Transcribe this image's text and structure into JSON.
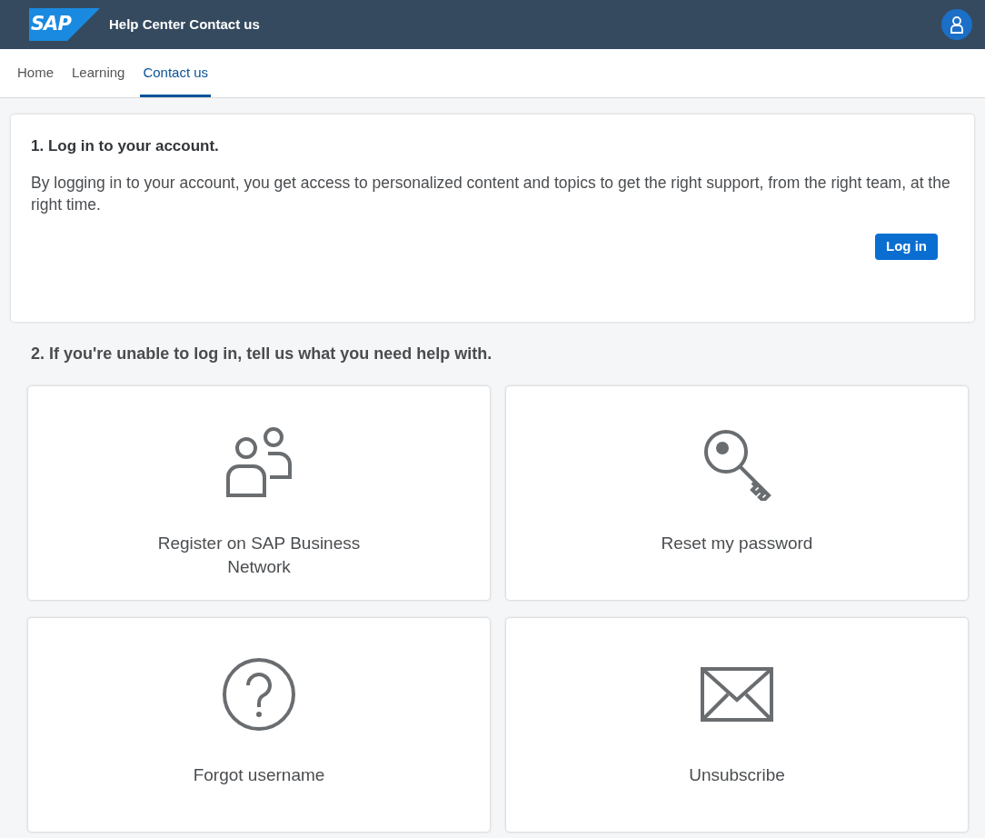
{
  "header": {
    "logo": "SAP",
    "title": "Help Center Contact us"
  },
  "tabs": [
    {
      "label": "Home",
      "selected": false
    },
    {
      "label": "Learning",
      "selected": false
    },
    {
      "label": "Contact us",
      "selected": true
    }
  ],
  "login_card": {
    "heading": "1. Log in to your account.",
    "text": "By logging in to your account, you get access to personalized content and topics to get the right support, from the right team, at the right time.",
    "button": "Log in"
  },
  "help_heading": "2. If you're unable to log in, tell us what you need help with.",
  "tiles": [
    {
      "kind": "users",
      "label": "Register on SAP Business Network"
    },
    {
      "kind": "key",
      "label": "Reset my password"
    },
    {
      "kind": "question",
      "label": "Forgot username"
    },
    {
      "kind": "envelope",
      "label": "Unsubscribe"
    }
  ]
}
